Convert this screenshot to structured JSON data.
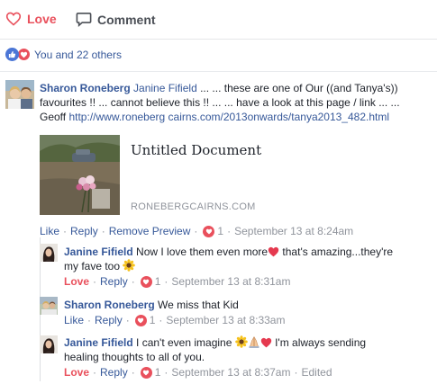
{
  "actions": {
    "love_label": "Love",
    "comment_label": "Comment"
  },
  "reactions": {
    "summary": "You and 22 others"
  },
  "main_comment": {
    "author": "Sharon Roneberg",
    "mention": "Janine Fifield",
    "text_line1": " ... ... these are one of Our ((and Tanya's))",
    "text_line2": "favourites !! ... cannot believe this !! ... ... have a look at this page / link ... ...",
    "text_line3_prefix": "Geoff ",
    "link": "http://www.roneberg cairns.com/2013onwards/tanya2013_482.html",
    "preview_title": "Untitled Document",
    "preview_domain": "RONEBERGCAIRNS.COM",
    "meta": {
      "like": "Like",
      "reply": "Reply",
      "remove_preview": "Remove Preview",
      "count": "1",
      "timestamp": "September 13 at 8:24am"
    }
  },
  "replies": [
    {
      "author": "Janine Fifield",
      "text_a": "Now I love them even more",
      "text_b": " that's amazing...they're",
      "text_c": "my fave too",
      "meta_love": "Love",
      "meta_reply": "Reply",
      "count": "1",
      "timestamp": "September 13 at 8:31am"
    },
    {
      "author": "Sharon Roneberg",
      "text_a": "We miss that Kid",
      "meta_like": "Like",
      "meta_reply": "Reply",
      "count": "1",
      "timestamp": "September 13 at 8:33am"
    },
    {
      "author": "Janine Fifield",
      "text_a": "I can't even imagine",
      "text_b": " I'm always sending",
      "text_c": "healing thoughts to all of you.",
      "meta_love": "Love",
      "meta_reply": "Reply",
      "count": "1",
      "timestamp": "September 13 at 8:37am",
      "edited": "Edited"
    }
  ],
  "colors": {
    "love": "#e9505c",
    "link": "#365899",
    "muted": "#90949c",
    "like_blue": "#4b76d6"
  },
  "icons": [
    "heart-outline-icon",
    "comment-bubble-icon",
    "like-reaction-icon",
    "love-reaction-icon",
    "heart-emoji-icon",
    "sunflower-emoji-icon",
    "praying-hands-emoji-icon"
  ]
}
